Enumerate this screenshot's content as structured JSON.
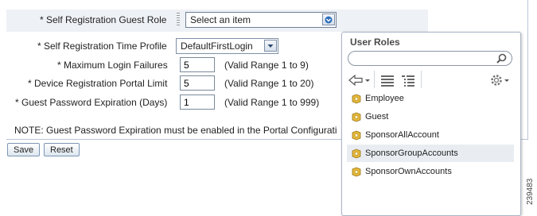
{
  "form": {
    "guest_role_label": "* Self Registration Guest Role",
    "guest_role_value": "Select an item",
    "time_profile_label": "* Self Registration Time Profile",
    "time_profile_value": "DefaultFirstLogin",
    "max_login_label": "* Maximum Login Failures",
    "max_login_value": "5",
    "max_login_range": "(Valid Range 1 to 9)",
    "device_limit_label": "* Device Registration Portal Limit",
    "device_limit_value": "5",
    "device_limit_range": "(Valid Range 1 to 20)",
    "pw_exp_label": "* Guest Password Expiration (Days)",
    "pw_exp_value": "1",
    "pw_exp_range": "(Valid Range 1 to 999)",
    "note": "NOTE: Guest Password Expiration must be enabled in the Portal Configurati"
  },
  "buttons": {
    "save": "Save",
    "reset": "Reset"
  },
  "popup": {
    "title": "User Roles",
    "search_value": "",
    "items": [
      "Employee",
      "Guest",
      "SponsorAllAccount",
      "SponsorGroupAccounts",
      "SponsorOwnAccounts"
    ],
    "highlighted_index": 3
  },
  "figure_id": "239483",
  "icons": [
    "dropdown-arrow-icon",
    "search-icon",
    "back-arrow-icon",
    "list-icon",
    "tree-list-icon",
    "gear-icon",
    "role-icon"
  ]
}
